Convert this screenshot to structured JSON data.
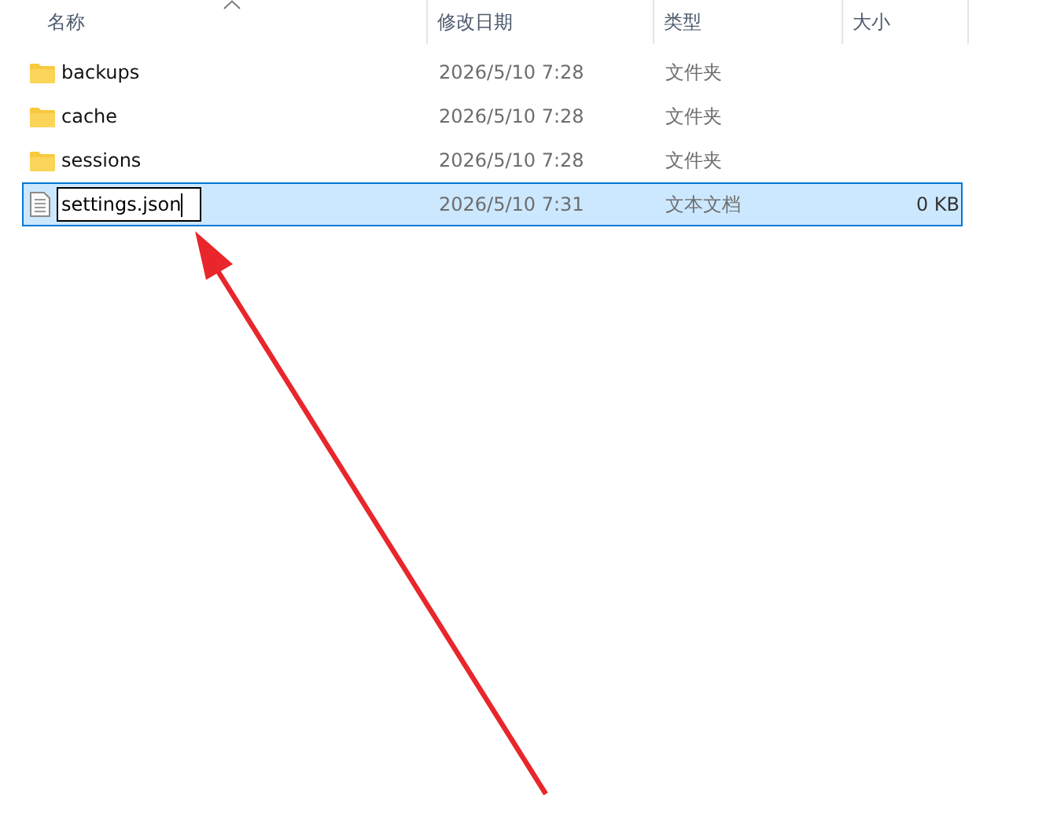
{
  "columns": [
    {
      "label": "名称",
      "sorted": true
    },
    {
      "label": "修改日期",
      "sorted": false
    },
    {
      "label": "类型",
      "sorted": false
    },
    {
      "label": "大小",
      "sorted": false
    }
  ],
  "rows": [
    {
      "kind": "folder",
      "name": "backups",
      "date": "2026/5/10 7:28",
      "type": "文件夹",
      "selected": false,
      "renaming": false
    },
    {
      "kind": "folder",
      "name": "cache",
      "date": "2026/5/10 7:28",
      "type": "文件夹",
      "selected": false,
      "renaming": false
    },
    {
      "kind": "folder",
      "name": "sessions",
      "date": "2026/5/10 7:28",
      "type": "文件夹",
      "selected": false,
      "renaming": false
    },
    {
      "kind": "file",
      "name": "settings.json",
      "date": "2026/5/10 7:31",
      "type": "文本文档",
      "size": "0 KB",
      "selected": true,
      "renaming": true
    }
  ]
}
